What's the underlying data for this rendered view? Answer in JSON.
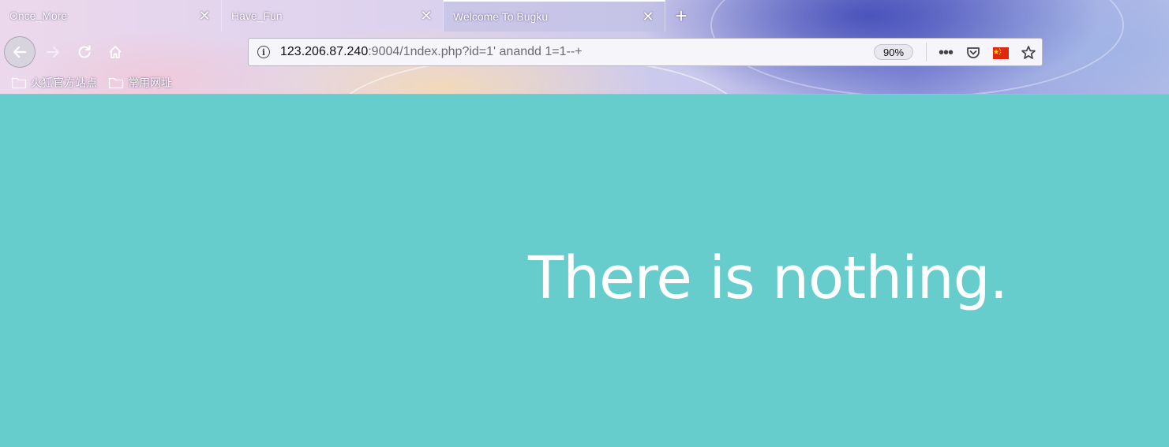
{
  "browser": {
    "tabs": [
      {
        "title": "Once_More",
        "active": false
      },
      {
        "title": "Have_Fun",
        "active": false
      },
      {
        "title": "Welcome To Bugku",
        "active": true
      }
    ],
    "new_tab_icon": "plus-icon",
    "nav_icons": [
      "back-arrow-icon",
      "forward-arrow-icon",
      "reload-icon",
      "home-icon"
    ],
    "address_bar": {
      "host": "123.206.87.240",
      "rest": ":9004/1ndex.php?id=1' anandd 1=1--+",
      "zoom": "90%",
      "icons": [
        "info-icon",
        "more-icon",
        "pocket-icon",
        "china-flag-icon",
        "star-icon"
      ]
    },
    "bookmarks": [
      {
        "label": "火狐官方站点",
        "icon": "folder-icon"
      },
      {
        "label": "常用网址",
        "icon": "folder-icon"
      }
    ]
  },
  "page": {
    "heading": "There is nothing.",
    "background_color": "#66cccc",
    "text_color": "#ffffff"
  }
}
